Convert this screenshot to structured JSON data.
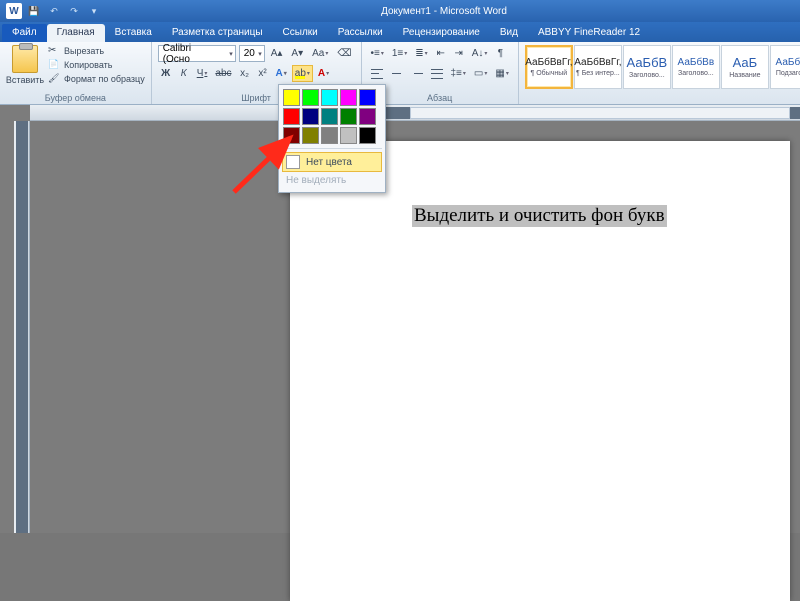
{
  "app": {
    "title": "Документ1  -  Microsoft Word"
  },
  "tabs": {
    "file": "Файл",
    "home": "Главная",
    "insert": "Вставка",
    "layout": "Разметка страницы",
    "refs": "Ссылки",
    "mail": "Рассылки",
    "review": "Рецензирование",
    "view": "Вид",
    "abbyy": "ABBYY FineReader 12"
  },
  "clipboard": {
    "paste": "Вставить",
    "cut": "Вырезать",
    "copy": "Копировать",
    "format_painter": "Формат по образцу",
    "group": "Буфер обмена"
  },
  "font": {
    "family": "Calibri (Осно",
    "size": "20",
    "group": "Шрифт"
  },
  "paragraph": {
    "group": "Абзац"
  },
  "styles": {
    "items": [
      {
        "sample": "АаБбВвГг,",
        "name": "¶ Обычный",
        "selected": true,
        "cls": ""
      },
      {
        "sample": "АаБбВвГг,",
        "name": "¶ Без интер...",
        "selected": false,
        "cls": ""
      },
      {
        "sample": "АаБбВ",
        "name": "Заголово...",
        "selected": false,
        "cls": "blue big"
      },
      {
        "sample": "АаБбВв",
        "name": "Заголово...",
        "selected": false,
        "cls": "blue"
      },
      {
        "sample": "АаБ",
        "name": "Название",
        "selected": false,
        "cls": "blue big"
      },
      {
        "sample": "АаБбВв",
        "name": "Подзагол...",
        "selected": false,
        "cls": "blue"
      }
    ]
  },
  "highlight_popup": {
    "colors": [
      "#ffff00",
      "#00ff00",
      "#00ffff",
      "#ff00ff",
      "#0000ff",
      "#ff0000",
      "#000080",
      "#008080",
      "#008000",
      "#800080",
      "#800000",
      "#808000",
      "#808080",
      "#c0c0c0",
      "#000000"
    ],
    "no_color": "Нет цвета",
    "stop": "Не выделять"
  },
  "document": {
    "selected_text": "Выделить и очистить фон букв"
  }
}
